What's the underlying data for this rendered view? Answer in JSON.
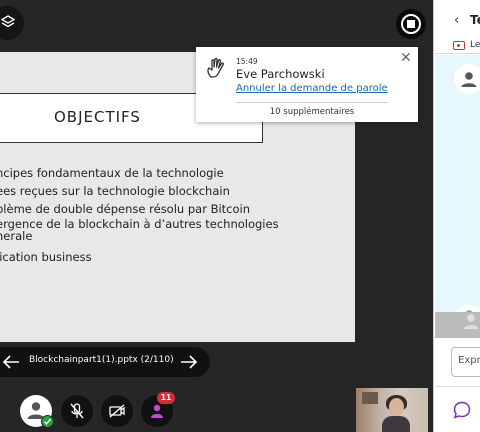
{
  "slide": {
    "title": "OBJECTIFS",
    "bullets": [
      "ncipes fondamentaux de la technologie",
      "ees reçues sur la technologie blockchain",
      "blème de double dépense résolu par Bitcoin",
      "ergence de la blockchain à d’autres technologies",
      "nerale",
      "lication business"
    ]
  },
  "notification": {
    "time": "15:49",
    "name": "Eve Parchowski",
    "action_link": "Annuler la demande de parole",
    "more_label": "10 supplémentaires"
  },
  "slide_nav": {
    "file_label": "Blockchainpart1(1).pptx  (2/110)"
  },
  "controls": {
    "raised_hands_count": "11"
  },
  "panel": {
    "title": "Te",
    "subrow_label": "Le",
    "message_placeholder": "Expr"
  },
  "colors": {
    "accent": "#1a66b2",
    "badge": "#d52d36",
    "status_ok": "#2e9e45",
    "chat_bg": "#e6f8fc",
    "chat_icon": "#7b2fb0"
  }
}
